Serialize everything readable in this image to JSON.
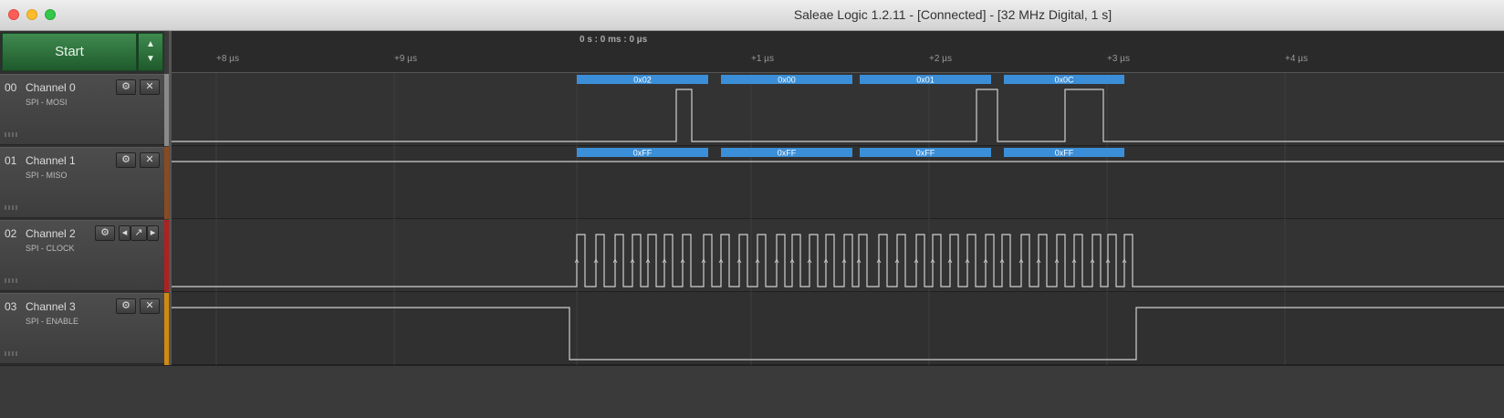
{
  "window": {
    "title": "Saleae Logic 1.2.11 - [Connected] - [32 MHz Digital, 1 s]"
  },
  "controls": {
    "start_label": "Start",
    "up_arrow": "▲",
    "down_arrow": "▼"
  },
  "timeline": {
    "cursor_label": "0 s : 0 ms : 0 µs",
    "ticks": [
      "+8 µs",
      "+9 µs",
      "+1 µs",
      "+2 µs",
      "+3 µs",
      "+4 µs"
    ]
  },
  "channels": [
    {
      "num": "00",
      "name": "Channel 0",
      "sub": "SPI - MOSI",
      "color": "#8a8a8a",
      "decoded": [
        "0x02",
        "0x00",
        "0x01",
        "0x0C"
      ]
    },
    {
      "num": "01",
      "name": "Channel 1",
      "sub": "SPI - MISO",
      "color": "#8b4a20",
      "decoded": [
        "0xFF",
        "0xFF",
        "0xFF",
        "0xFF"
      ]
    },
    {
      "num": "02",
      "name": "Channel 2",
      "sub": "SPI - CLOCK",
      "color": "#b02020",
      "decoded": []
    },
    {
      "num": "03",
      "name": "Channel 3",
      "sub": "SPI - ENABLE",
      "color": "#d08a10",
      "decoded": []
    }
  ],
  "icons": {
    "gear": "⚙",
    "close": "✕",
    "left": "◂",
    "edge": "↗",
    "right": "▸"
  },
  "colors": {
    "decode_bg": "#3b8fd8",
    "wave": "#d0d0d0",
    "start_green": "#2e7040"
  }
}
